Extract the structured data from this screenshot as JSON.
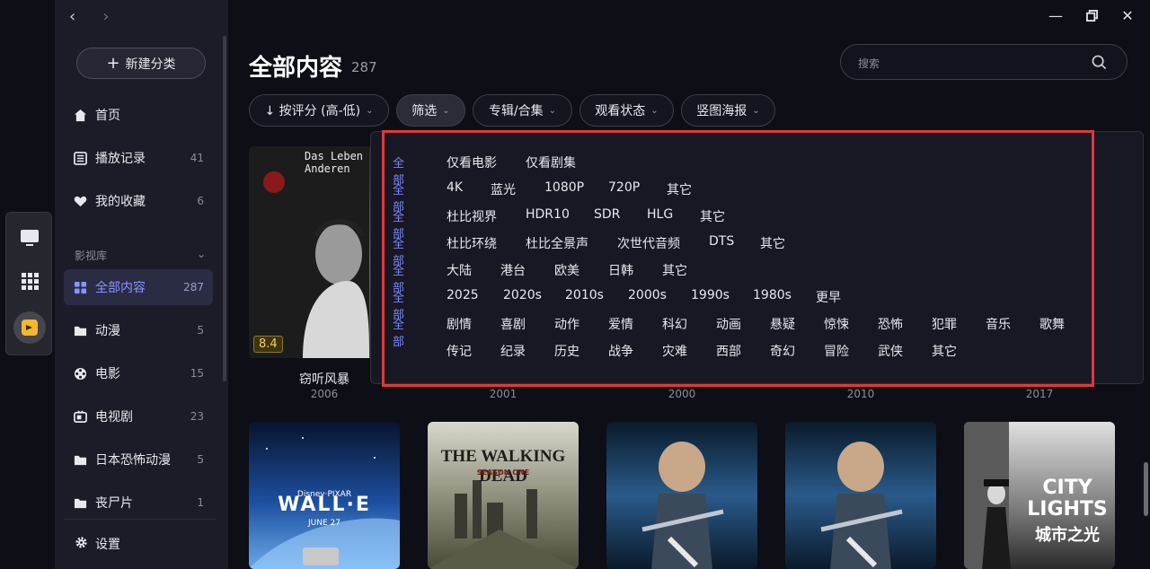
{
  "sidebar": {
    "new_category": "新建分类",
    "items_top": [
      {
        "label": "首页",
        "count": ""
      },
      {
        "label": "播放记录",
        "count": "41"
      },
      {
        "label": "我的收藏",
        "count": "6"
      }
    ],
    "section_title": "影视库",
    "library": [
      {
        "label": "全部内容",
        "count": "287"
      },
      {
        "label": "动漫",
        "count": "5"
      },
      {
        "label": "电影",
        "count": "15"
      },
      {
        "label": "电视剧",
        "count": "23"
      },
      {
        "label": "日本恐怖动漫",
        "count": "5"
      },
      {
        "label": "丧尸片",
        "count": "1"
      }
    ],
    "settings": "设置"
  },
  "header": {
    "title": "全部内容",
    "count": "287",
    "search_placeholder": "搜索"
  },
  "toolbar": {
    "sort": "↓ 按评分 (高-低)",
    "filter": "筛选",
    "album": "专辑/合集",
    "watch_status": "观看状态",
    "poster": "竖图海报"
  },
  "filters": {
    "all_label": "全部",
    "type": [
      "仅看电影",
      "仅看剧集"
    ],
    "resolution": [
      "4K",
      "蓝光",
      "1080P",
      "720P",
      "其它"
    ],
    "video": [
      "杜比视界",
      "HDR10",
      "SDR",
      "HLG",
      "其它"
    ],
    "audio": [
      "杜比环绕",
      "杜比全景声",
      "次世代音频",
      "DTS",
      "其它"
    ],
    "region": [
      "大陆",
      "港台",
      "欧美",
      "日韩",
      "其它"
    ],
    "year": [
      "2025",
      "2020s",
      "2010s",
      "2000s",
      "1990s",
      "1980s",
      "更早"
    ],
    "genre_row1": [
      "剧情",
      "喜剧",
      "动作",
      "爱情",
      "科幻",
      "动画",
      "悬疑",
      "惊悚",
      "恐怖",
      "犯罪",
      "音乐",
      "歌舞"
    ],
    "genre_row2": [
      "传记",
      "纪录",
      "历史",
      "战争",
      "灾难",
      "西部",
      "奇幻",
      "冒险",
      "武侠",
      "其它"
    ]
  },
  "posters_row1": [
    {
      "title": "窃听风暴",
      "year": "2006",
      "rating": "8.4",
      "poster_text": "Das Leben der Anderen"
    },
    {
      "year": "2001"
    },
    {
      "year": "2000"
    },
    {
      "year": "2010"
    },
    {
      "year": "2017"
    }
  ],
  "posters_row2": [
    {
      "poster_text": "WALL·E",
      "sub": "JUNE 27",
      "brand": "Disney·PIXAR"
    },
    {
      "poster_text": "THE WALKING DEAD",
      "sub": "SEASON ONE"
    },
    {
      "poster_text": ""
    },
    {
      "poster_text": ""
    },
    {
      "poster_text": "CITY LIGHTS",
      "sub": "城市之光"
    }
  ],
  "colors": {
    "accent": "#7b86ff",
    "highlight": "#e0393b",
    "bg": "#0d0e16",
    "sidebar": "#1b1c27"
  }
}
